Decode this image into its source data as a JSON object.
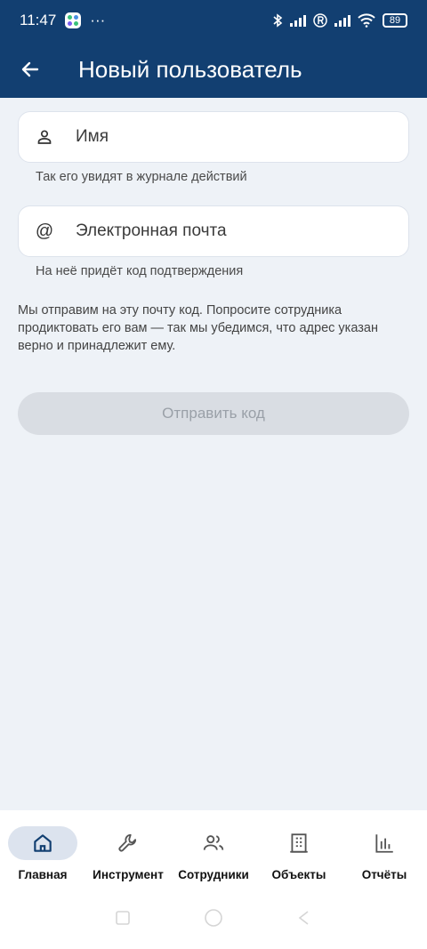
{
  "status": {
    "time": "11:47",
    "more": "···",
    "battery": "89"
  },
  "appbar": {
    "title": "Новый пользователь"
  },
  "form": {
    "name_placeholder": "Имя",
    "name_hint": "Так его увидят в журнале действий",
    "email_icon": "@",
    "email_placeholder": "Электронная почта",
    "email_hint": "На неё придёт код подтверждения",
    "info": "Мы отправим на эту почту код. Попросите сотрудника продиктовать его вам — так мы убедимся, что адрес указан верно и принадлежит ему.",
    "submit_label": "Отправить код"
  },
  "nav": {
    "items": [
      {
        "label": "Главная",
        "icon": "home-icon"
      },
      {
        "label": "Инструмент",
        "icon": "wrench-icon"
      },
      {
        "label": "Сотрудники",
        "icon": "people-icon"
      },
      {
        "label": "Объекты",
        "icon": "building-icon"
      },
      {
        "label": "Отчёты",
        "icon": "bar-chart-icon"
      }
    ]
  },
  "colors": {
    "header": "#123f71",
    "background": "#eef2f7",
    "active_nav": "#dce3ee"
  }
}
